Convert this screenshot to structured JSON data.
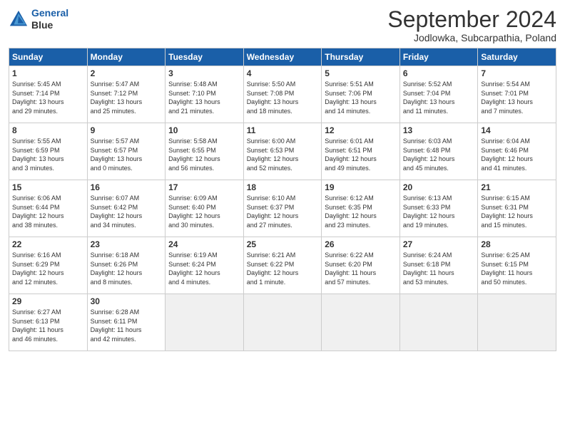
{
  "header": {
    "logo_line1": "General",
    "logo_line2": "Blue",
    "month_title": "September 2024",
    "subtitle": "Jodlowka, Subcarpathia, Poland"
  },
  "weekdays": [
    "Sunday",
    "Monday",
    "Tuesday",
    "Wednesday",
    "Thursday",
    "Friday",
    "Saturday"
  ],
  "weeks": [
    [
      {
        "day": "1",
        "info": "Sunrise: 5:45 AM\nSunset: 7:14 PM\nDaylight: 13 hours\nand 29 minutes."
      },
      {
        "day": "2",
        "info": "Sunrise: 5:47 AM\nSunset: 7:12 PM\nDaylight: 13 hours\nand 25 minutes."
      },
      {
        "day": "3",
        "info": "Sunrise: 5:48 AM\nSunset: 7:10 PM\nDaylight: 13 hours\nand 21 minutes."
      },
      {
        "day": "4",
        "info": "Sunrise: 5:50 AM\nSunset: 7:08 PM\nDaylight: 13 hours\nand 18 minutes."
      },
      {
        "day": "5",
        "info": "Sunrise: 5:51 AM\nSunset: 7:06 PM\nDaylight: 13 hours\nand 14 minutes."
      },
      {
        "day": "6",
        "info": "Sunrise: 5:52 AM\nSunset: 7:04 PM\nDaylight: 13 hours\nand 11 minutes."
      },
      {
        "day": "7",
        "info": "Sunrise: 5:54 AM\nSunset: 7:01 PM\nDaylight: 13 hours\nand 7 minutes."
      }
    ],
    [
      {
        "day": "8",
        "info": "Sunrise: 5:55 AM\nSunset: 6:59 PM\nDaylight: 13 hours\nand 3 minutes."
      },
      {
        "day": "9",
        "info": "Sunrise: 5:57 AM\nSunset: 6:57 PM\nDaylight: 13 hours\nand 0 minutes."
      },
      {
        "day": "10",
        "info": "Sunrise: 5:58 AM\nSunset: 6:55 PM\nDaylight: 12 hours\nand 56 minutes."
      },
      {
        "day": "11",
        "info": "Sunrise: 6:00 AM\nSunset: 6:53 PM\nDaylight: 12 hours\nand 52 minutes."
      },
      {
        "day": "12",
        "info": "Sunrise: 6:01 AM\nSunset: 6:51 PM\nDaylight: 12 hours\nand 49 minutes."
      },
      {
        "day": "13",
        "info": "Sunrise: 6:03 AM\nSunset: 6:48 PM\nDaylight: 12 hours\nand 45 minutes."
      },
      {
        "day": "14",
        "info": "Sunrise: 6:04 AM\nSunset: 6:46 PM\nDaylight: 12 hours\nand 41 minutes."
      }
    ],
    [
      {
        "day": "15",
        "info": "Sunrise: 6:06 AM\nSunset: 6:44 PM\nDaylight: 12 hours\nand 38 minutes."
      },
      {
        "day": "16",
        "info": "Sunrise: 6:07 AM\nSunset: 6:42 PM\nDaylight: 12 hours\nand 34 minutes."
      },
      {
        "day": "17",
        "info": "Sunrise: 6:09 AM\nSunset: 6:40 PM\nDaylight: 12 hours\nand 30 minutes."
      },
      {
        "day": "18",
        "info": "Sunrise: 6:10 AM\nSunset: 6:37 PM\nDaylight: 12 hours\nand 27 minutes."
      },
      {
        "day": "19",
        "info": "Sunrise: 6:12 AM\nSunset: 6:35 PM\nDaylight: 12 hours\nand 23 minutes."
      },
      {
        "day": "20",
        "info": "Sunrise: 6:13 AM\nSunset: 6:33 PM\nDaylight: 12 hours\nand 19 minutes."
      },
      {
        "day": "21",
        "info": "Sunrise: 6:15 AM\nSunset: 6:31 PM\nDaylight: 12 hours\nand 15 minutes."
      }
    ],
    [
      {
        "day": "22",
        "info": "Sunrise: 6:16 AM\nSunset: 6:29 PM\nDaylight: 12 hours\nand 12 minutes."
      },
      {
        "day": "23",
        "info": "Sunrise: 6:18 AM\nSunset: 6:26 PM\nDaylight: 12 hours\nand 8 minutes."
      },
      {
        "day": "24",
        "info": "Sunrise: 6:19 AM\nSunset: 6:24 PM\nDaylight: 12 hours\nand 4 minutes."
      },
      {
        "day": "25",
        "info": "Sunrise: 6:21 AM\nSunset: 6:22 PM\nDaylight: 12 hours\nand 1 minute."
      },
      {
        "day": "26",
        "info": "Sunrise: 6:22 AM\nSunset: 6:20 PM\nDaylight: 11 hours\nand 57 minutes."
      },
      {
        "day": "27",
        "info": "Sunrise: 6:24 AM\nSunset: 6:18 PM\nDaylight: 11 hours\nand 53 minutes."
      },
      {
        "day": "28",
        "info": "Sunrise: 6:25 AM\nSunset: 6:15 PM\nDaylight: 11 hours\nand 50 minutes."
      }
    ],
    [
      {
        "day": "29",
        "info": "Sunrise: 6:27 AM\nSunset: 6:13 PM\nDaylight: 11 hours\nand 46 minutes."
      },
      {
        "day": "30",
        "info": "Sunrise: 6:28 AM\nSunset: 6:11 PM\nDaylight: 11 hours\nand 42 minutes."
      },
      {
        "day": "",
        "info": ""
      },
      {
        "day": "",
        "info": ""
      },
      {
        "day": "",
        "info": ""
      },
      {
        "day": "",
        "info": ""
      },
      {
        "day": "",
        "info": ""
      }
    ]
  ]
}
